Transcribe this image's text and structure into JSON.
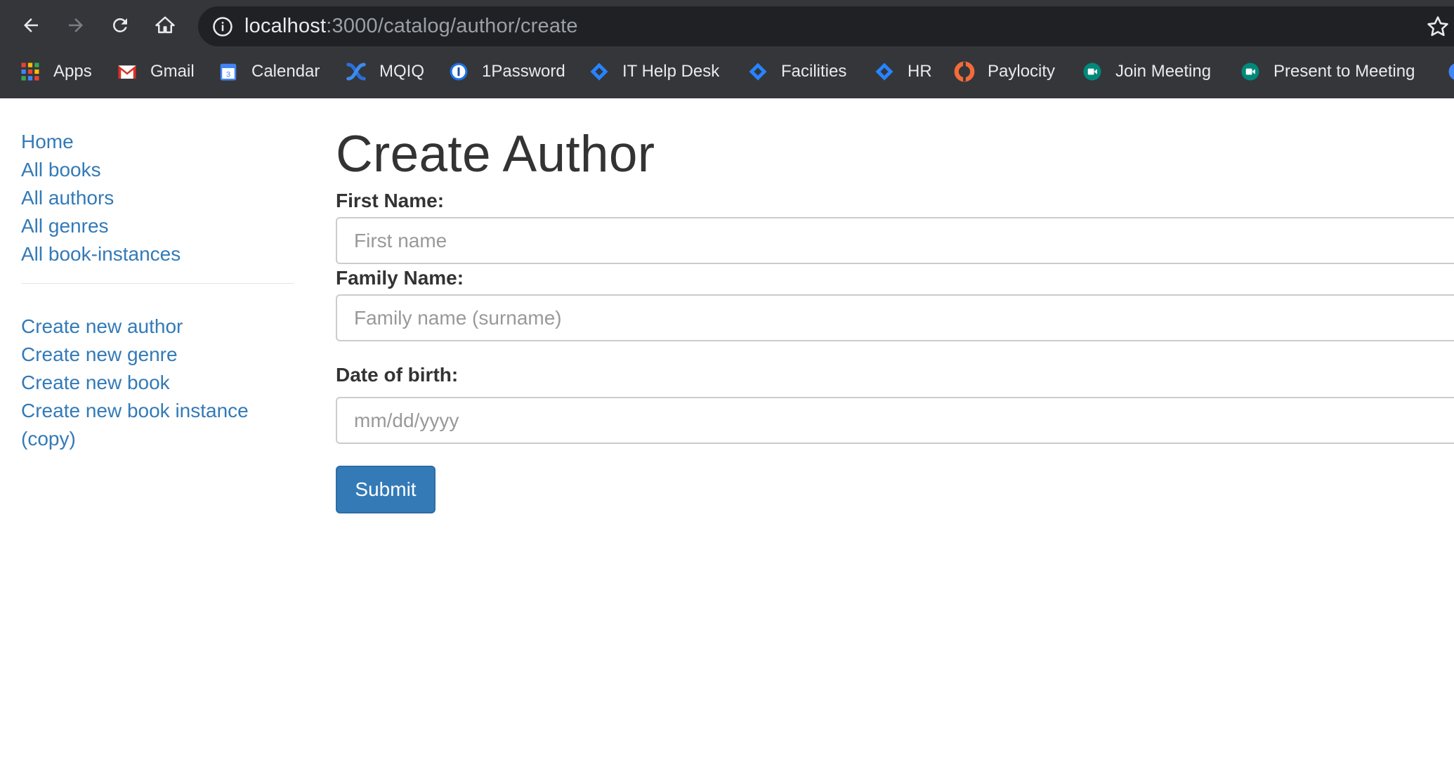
{
  "browser": {
    "url_host": "localhost",
    "url_path": ":3000/catalog/author/create",
    "bookmarks": [
      {
        "label": "Apps",
        "icon": "apps-grid-icon"
      },
      {
        "label": "Gmail",
        "icon": "gmail-icon"
      },
      {
        "label": "Calendar",
        "icon": "calendar-icon",
        "badge": "3"
      },
      {
        "label": "MQIQ",
        "icon": "mqiq-icon"
      },
      {
        "label": "1Password",
        "icon": "1password-icon"
      },
      {
        "label": "IT Help Desk",
        "icon": "jira-icon"
      },
      {
        "label": "Facilities",
        "icon": "jira-icon"
      },
      {
        "label": "HR",
        "icon": "jira-icon"
      },
      {
        "label": "Paylocity",
        "icon": "paylocity-icon"
      },
      {
        "label": "Join Meeting",
        "icon": "meet-icon"
      },
      {
        "label": "Present to Meeting",
        "icon": "meet-icon"
      }
    ]
  },
  "sidebar": {
    "nav": [
      "Home",
      "All books",
      "All authors",
      "All genres",
      "All book-instances"
    ],
    "create": [
      "Create new author",
      "Create new genre",
      "Create new book",
      "Create new book instance (copy)"
    ]
  },
  "main": {
    "title": "Create Author",
    "first_name_label": "First Name:",
    "first_name_placeholder": "First name",
    "family_name_label": "Family Name:",
    "family_name_placeholder": "Family name (surname)",
    "dob_label": "Date of birth:",
    "dob_placeholder": "mm/dd/yyyy",
    "submit_label": "Submit"
  },
  "colors": {
    "link": "#337ab7",
    "button": "#337ab7",
    "chrome": "#35363a",
    "omnibox": "#202124"
  }
}
